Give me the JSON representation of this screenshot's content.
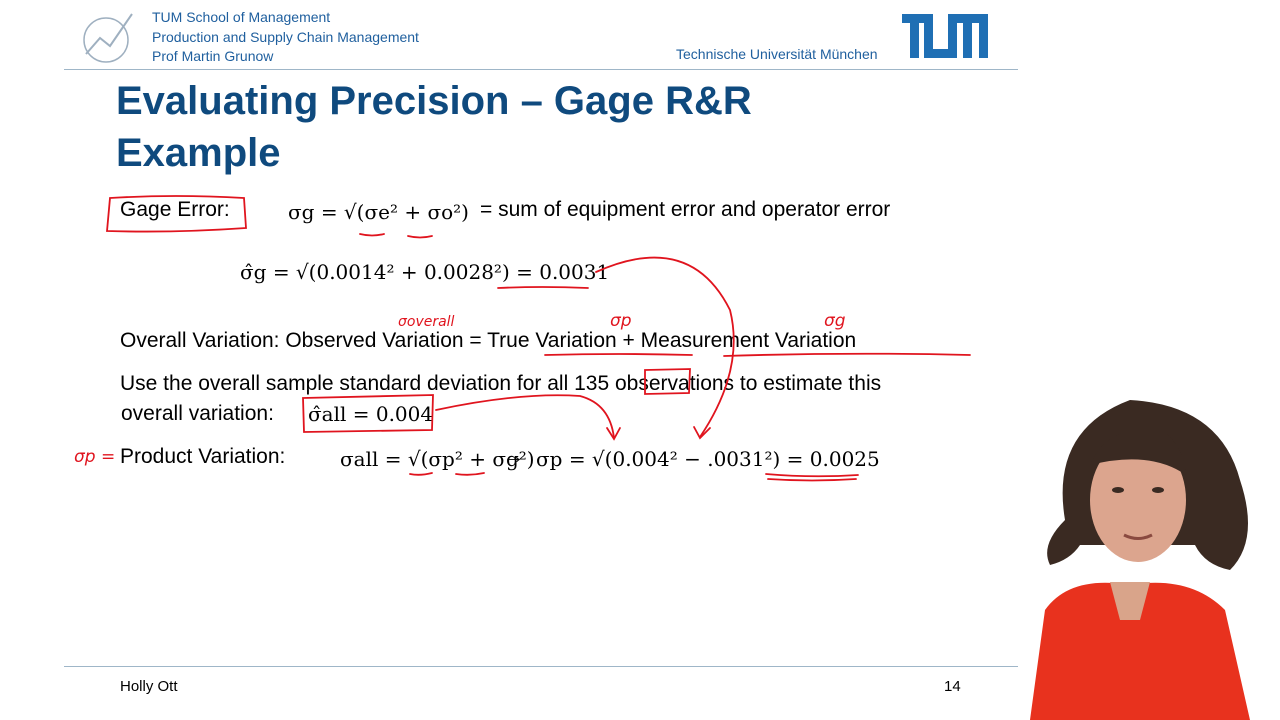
{
  "header": {
    "institution_lines": [
      "TUM School of Management",
      "Production and Supply Chain Management",
      "Prof Martin Grunow"
    ],
    "university": "Technische Universität München"
  },
  "slide": {
    "title": "Evaluating Precision – Gage R&R Example",
    "gage_error_label": "Gage Error:",
    "gage_formula": "σg = √(σe² + σo²)",
    "gage_description": "= sum of equipment error and operator error",
    "gage_estimate": "σ̂g = √(0.0014² + 0.0028²) = 0.0031",
    "overall_variation": {
      "prefix": "Overall Variation: Observed Variation",
      "equals": "=",
      "true_variation": "True Variation",
      "plus": "+",
      "measurement_variation": "Measurement Variation"
    },
    "use_overall_line1": "Use the overall sample standard deviation for all",
    "count": "135",
    "use_overall_line1_end": "observations to estimate this",
    "use_overall_line2": "overall variation:",
    "sigma_all_estimate": "σ̂all = 0.004",
    "product_label": "Product Variation:",
    "product_formula": "σall = √(σp² + σg²)",
    "arrow": "→",
    "product_estimate": "σp = √(0.004² − .0031²) = 0.0025"
  },
  "annotations": {
    "sigma_overall": "σoverall",
    "sigma_p": "σp",
    "sigma_g": "σg",
    "sigma_p_left": "σp ="
  },
  "footer": {
    "presenter": "Holly Ott",
    "page": "14"
  },
  "colors": {
    "title": "#0f4a7e",
    "header_text": "#1f5f9e",
    "ink": "#e0141e"
  }
}
